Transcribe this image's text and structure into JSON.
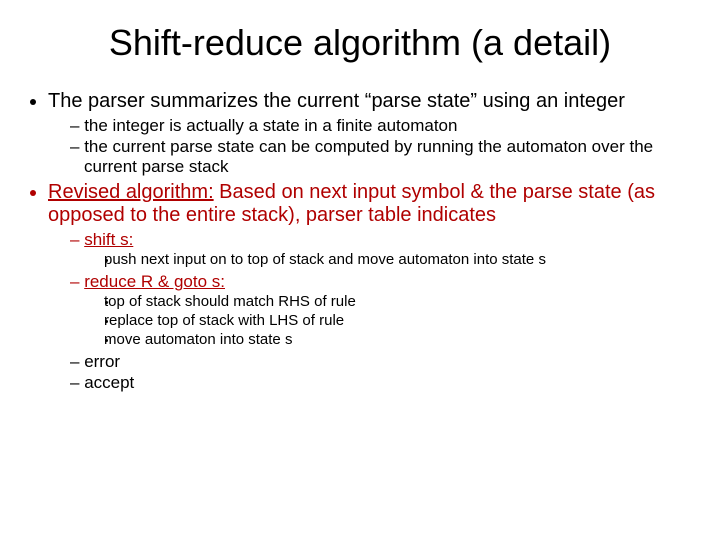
{
  "title": "Shift-reduce algorithm (a detail)",
  "bullets": {
    "b1": "The parser summarizes the current “parse state” using an integer",
    "b1a": "the integer is actually a state in a finite automaton",
    "b1b": "the current parse state can be computed by running the automaton over the current parse stack",
    "b2_lead": "Revised algorithm:",
    "b2_rest": "  Based on next input symbol & the parse state (as opposed to the entire stack), parser table indicates",
    "b2a": "shift s:",
    "b2a1": "push next input on to top of stack and move automaton into state s",
    "b2b": "reduce R & goto s:",
    "b2b1": "top of stack should match RHS of rule",
    "b2b2": "replace top of stack with LHS of rule",
    "b2b3": "move automaton into state s",
    "b2c": "error",
    "b2d": "accept"
  }
}
